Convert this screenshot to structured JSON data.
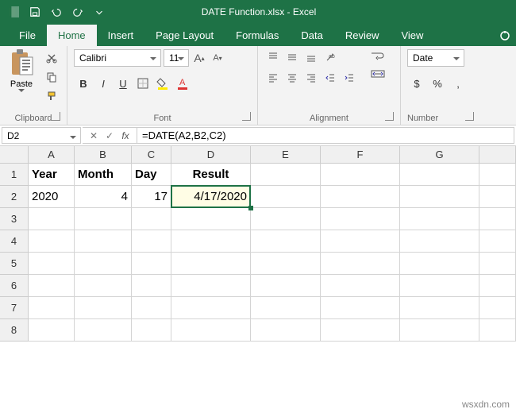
{
  "title": "DATE Function.xlsx - Excel",
  "tabs": [
    "File",
    "Home",
    "Insert",
    "Page Layout",
    "Formulas",
    "Data",
    "Review",
    "View"
  ],
  "activeTab": 1,
  "clipboard": {
    "paste": "Paste",
    "title": "Clipboard"
  },
  "font": {
    "name": "Calibri",
    "size": "11",
    "increase": "A",
    "decrease": "A",
    "bold": "B",
    "italic": "I",
    "underline": "U",
    "title": "Font"
  },
  "alignment": {
    "title": "Alignment"
  },
  "number": {
    "format": "Date",
    "currency": "$",
    "percent": "%",
    "comma": ",",
    "title": "Number"
  },
  "namebox": "D2",
  "formula": "=DATE(A2,B2,C2)",
  "cols": [
    "A",
    "B",
    "C",
    "D",
    "E",
    "F",
    "G"
  ],
  "rows": [
    "1",
    "2",
    "3",
    "4",
    "5",
    "6",
    "7",
    "8"
  ],
  "cells": {
    "A1": "Year",
    "B1": "Month",
    "C1": "Day",
    "D1": "Result",
    "A2": "2020",
    "B2": "4",
    "C2": "17",
    "D2": "4/17/2020"
  },
  "watermark": "wsxdn.com"
}
